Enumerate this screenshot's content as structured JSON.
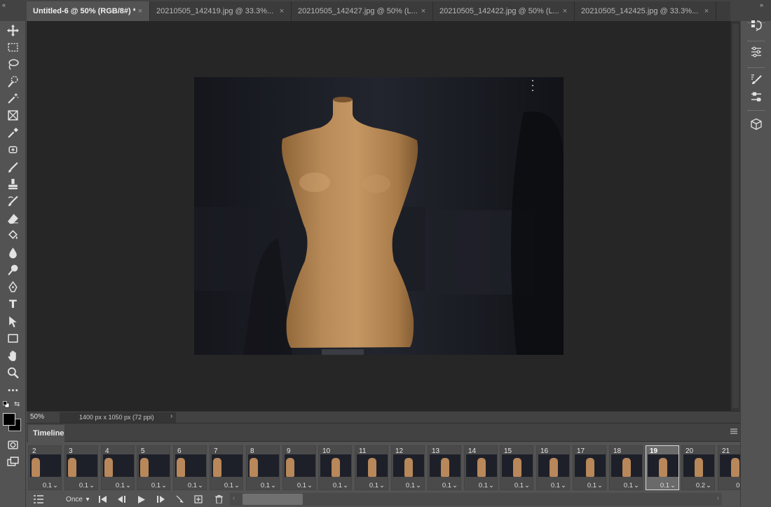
{
  "tabs": [
    {
      "label": "Untitled-6 @ 50% (RGB/8#) *",
      "active": true
    },
    {
      "label": "20210505_142419.jpg @ 33.3%...",
      "active": false
    },
    {
      "label": "20210505_142427.jpg @ 50% (L...",
      "active": false
    },
    {
      "label": "20210505_142422.jpg @ 50% (L...",
      "active": false
    },
    {
      "label": "20210505_142425.jpg @ 33.3%...",
      "active": false
    }
  ],
  "tab_close_glyph": "×",
  "status": {
    "zoom": "50%",
    "doc_info": "1400 px x 1050 px (72 ppi)"
  },
  "timeline": {
    "title": "Timeline",
    "loop": "Once",
    "frames": [
      {
        "num": "2",
        "delay": "0.1"
      },
      {
        "num": "3",
        "delay": "0.1"
      },
      {
        "num": "4",
        "delay": "0.1"
      },
      {
        "num": "5",
        "delay": "0.1"
      },
      {
        "num": "6",
        "delay": "0.1"
      },
      {
        "num": "7",
        "delay": "0.1"
      },
      {
        "num": "8",
        "delay": "0.1"
      },
      {
        "num": "9",
        "delay": "0.1"
      },
      {
        "num": "10",
        "delay": "0.1"
      },
      {
        "num": "11",
        "delay": "0.1"
      },
      {
        "num": "12",
        "delay": "0.1"
      },
      {
        "num": "13",
        "delay": "0.1"
      },
      {
        "num": "14",
        "delay": "0.1"
      },
      {
        "num": "15",
        "delay": "0.1"
      },
      {
        "num": "16",
        "delay": "0.1"
      },
      {
        "num": "17",
        "delay": "0.1"
      },
      {
        "num": "18",
        "delay": "0.1"
      },
      {
        "num": "19",
        "delay": "0.1",
        "selected": true
      },
      {
        "num": "20",
        "delay": "0.2"
      },
      {
        "num": "21",
        "delay": "0."
      }
    ]
  },
  "toolbar_icons": [
    "move-icon",
    "marquee-icon",
    "lasso-icon",
    "quick-select-icon",
    "crop-icon",
    "frame-icon",
    "eyedropper-icon",
    "healing-brush-icon",
    "brush-icon",
    "clone-stamp-icon",
    "history-brush-icon",
    "eraser-icon",
    "paint-bucket-icon",
    "blur-icon",
    "dodge-icon",
    "pen-icon",
    "type-icon",
    "path-select-icon",
    "rectangle-icon",
    "hand-icon",
    "zoom-icon",
    "more-tools-icon"
  ],
  "right_panel_icons": [
    "history-icon",
    "adjustments-icon",
    "brush-settings-icon",
    "properties-icon",
    "3d-icon"
  ],
  "colors": {
    "foreground": "#000000",
    "background": "#ffffff",
    "canvas_bg": "#262626",
    "ui_bg": "#535353"
  }
}
